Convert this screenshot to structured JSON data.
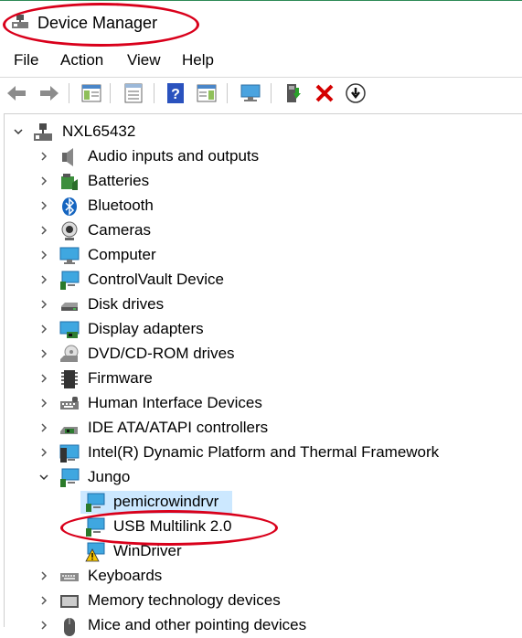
{
  "window": {
    "title": "Device Manager"
  },
  "menu": [
    "File",
    "Action",
    "View",
    "Help"
  ],
  "tree": {
    "root": "NXL65432",
    "categories": [
      "Audio inputs and outputs",
      "Batteries",
      "Bluetooth",
      "Cameras",
      "Computer",
      "ControlVault Device",
      "Disk drives",
      "Display adapters",
      "DVD/CD-ROM drives",
      "Firmware",
      "Human Interface Devices",
      "IDE ATA/ATAPI controllers",
      "Intel(R) Dynamic Platform and Thermal Framework",
      "Jungo"
    ],
    "jungo_children": [
      "pemicrowindrvr",
      "USB Multilink 2.0",
      "WinDriver"
    ],
    "after": [
      "Keyboards",
      "Memory technology devices",
      "Mice and other pointing devices"
    ]
  },
  "colors": {
    "annotation": "#d9001b",
    "selection": "#cce8ff"
  }
}
